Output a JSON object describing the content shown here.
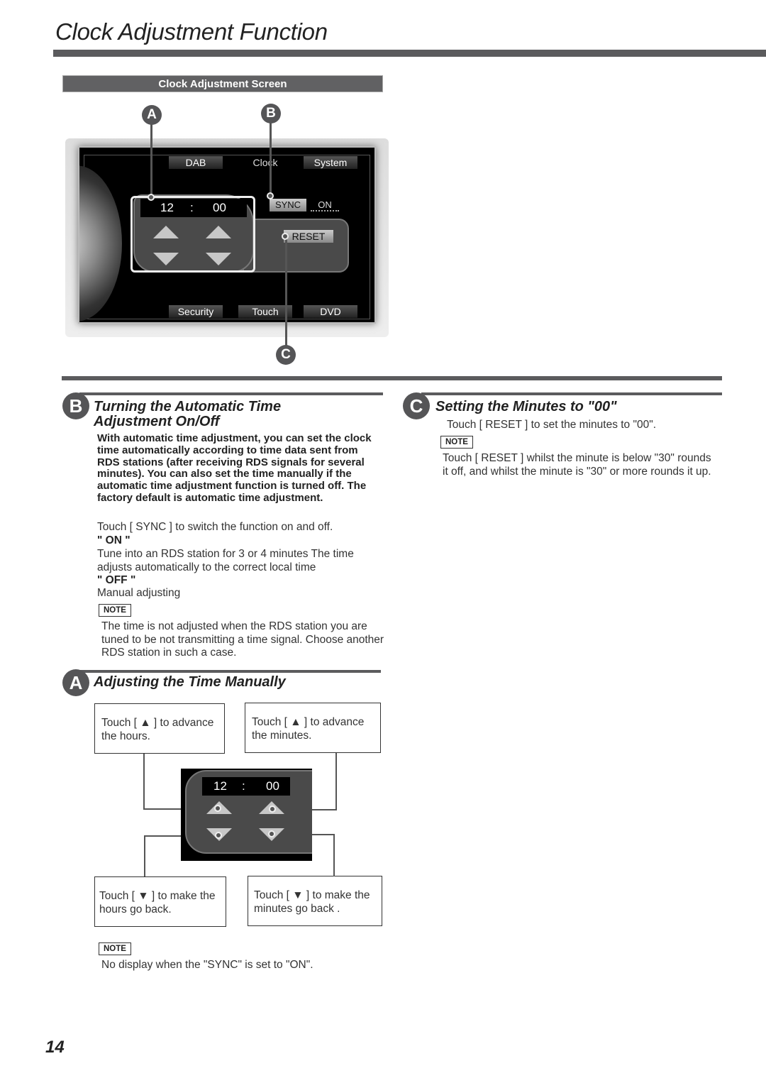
{
  "page": {
    "title": "Clock Adjustment Function",
    "page_number": "14"
  },
  "screen_figure": {
    "label": "Clock Adjustment Screen",
    "markers": {
      "a": "A",
      "b": "B",
      "c": "C"
    },
    "tabs_top": [
      "DAB",
      "Clock",
      "System"
    ],
    "tabs_bottom": [
      "Security",
      "Touch",
      "DVD"
    ],
    "time": {
      "hours": "12",
      "separator": ":",
      "minutes": "00"
    },
    "sync_button": "SYNC",
    "sync_value": "ON",
    "reset_button": "RESET"
  },
  "section_b": {
    "marker": "B",
    "title_line1": "Turning the Automatic Time",
    "title_line2": "Adjustment On/Off",
    "intro": "With automatic time adjustment, you can set the clock time automatically according to time data sent from RDS stations (after receiving RDS signals for several minutes). You can also set the time manually if the automatic time adjustment function is turned off. The factory default is automatic time adjustment.",
    "instruction": "Touch [ SYNC ] to switch the function on and off.",
    "on_label": "\" ON \"",
    "on_text": "Tune into an RDS station for 3 or 4 minutes  The time adjusts automatically to the correct local time",
    "off_label": "\" OFF \"",
    "off_text": "Manual adjusting",
    "note_label": "NOTE",
    "note_text": "The time is not adjusted when the RDS station you are tuned to be not transmitting a time signal. Choose another RDS station in such a case."
  },
  "section_c": {
    "marker": "C",
    "title": "Setting the Minutes to \"00\"",
    "instruction": "Touch [ RESET ] to set the minutes to \"00\".",
    "note_label": "NOTE",
    "note_text": "Touch [ RESET ] whilst the minute is below \"30\" rounds it off, and whilst the minute is \"30\" or more rounds it up."
  },
  "section_a": {
    "marker": "A",
    "title": "Adjusting the Time Manually",
    "callouts": {
      "hours_up": "Touch [ ▲ ] to advance the hours.",
      "minutes_up": "Touch [ ▲ ] to advance the minutes.",
      "hours_down": "Touch [ ▼ ] to make the hours go back.",
      "minutes_down": "Touch [ ▼ ] to make the minutes go back ."
    },
    "mini_time": {
      "hours": "12",
      "separator": ":",
      "minutes": "00"
    },
    "note_label": "NOTE",
    "note_text": "No display when the \"SYNC\" is set to \"ON\"."
  }
}
